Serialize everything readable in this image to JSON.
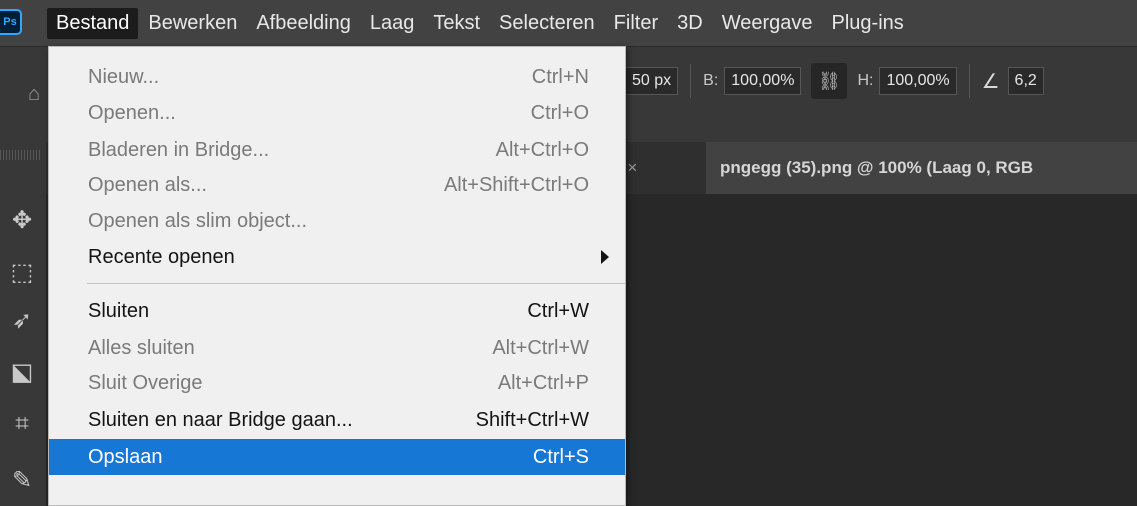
{
  "app": {
    "logo": "Ps"
  },
  "menubar": {
    "items": [
      {
        "label": "Bestand",
        "active": true
      },
      {
        "label": "Bewerken"
      },
      {
        "label": "Afbeelding"
      },
      {
        "label": "Laag"
      },
      {
        "label": "Tekst"
      },
      {
        "label": "Selecteren"
      },
      {
        "label": "Filter"
      },
      {
        "label": "3D"
      },
      {
        "label": "Weergave"
      },
      {
        "label": "Plug-ins"
      }
    ]
  },
  "options_bar": {
    "width_value": "50 px",
    "b_label": "B:",
    "b_value": "100,00%",
    "link_icon": "link-icon",
    "h_label": "H:",
    "h_value": "100,00%",
    "angle_icon": "angle-icon",
    "angle_value": "6,2"
  },
  "tabs": {
    "inactive_suffix": "* ×",
    "active_label": "pngegg (35).png @ 100% (Laag 0, RGB"
  },
  "menu": {
    "items": [
      {
        "label": "Nieuw...",
        "shortcut": "Ctrl+N",
        "enabled": false
      },
      {
        "label": "Openen...",
        "shortcut": "Ctrl+O",
        "enabled": false
      },
      {
        "label": "Bladeren in Bridge...",
        "shortcut": "Alt+Ctrl+O",
        "enabled": false
      },
      {
        "label": "Openen als...",
        "shortcut": "Alt+Shift+Ctrl+O",
        "enabled": false
      },
      {
        "label": "Openen als slim object...",
        "shortcut": "",
        "enabled": false
      },
      {
        "label": "Recente openen",
        "shortcut": "",
        "enabled": true,
        "submenu": true
      },
      {
        "label": "Sluiten",
        "shortcut": "Ctrl+W",
        "enabled": true
      },
      {
        "label": "Alles sluiten",
        "shortcut": "Alt+Ctrl+W",
        "enabled": false
      },
      {
        "label": "Sluit Overige",
        "shortcut": "Alt+Ctrl+P",
        "enabled": false
      },
      {
        "label": "Sluiten en naar Bridge gaan...",
        "shortcut": "Shift+Ctrl+W",
        "enabled": true
      },
      {
        "label": "Opslaan",
        "shortcut": "Ctrl+S",
        "enabled": true,
        "highlighted": true
      }
    ]
  },
  "colors": {
    "highlight": "#1777d4",
    "menu_bg": "#f0f0f0",
    "menubar_bg": "#424242"
  }
}
